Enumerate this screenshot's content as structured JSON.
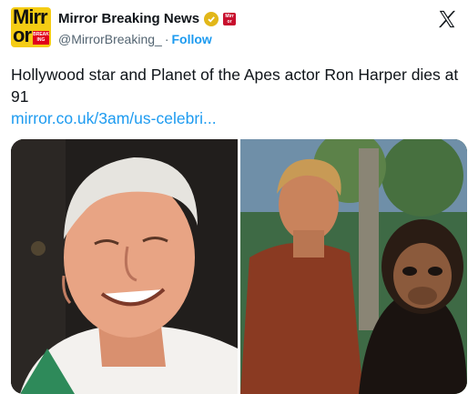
{
  "header": {
    "avatar_icon": "mirror-logo-icon",
    "avatar_text_top": "Mirr",
    "avatar_text_bottom": "or",
    "avatar_badge": "BREAK ING",
    "display_name": "Mirror Breaking News",
    "verified_icon": "gold-verified-badge-icon",
    "affiliate_icon": "mirror-affiliate-badge-icon",
    "affiliate_text": "Mirr or",
    "handle": "@MirrorBreaking_",
    "separator": "·",
    "follow_label": "Follow",
    "platform_icon": "x-logo-icon"
  },
  "tweet": {
    "text": "Hollywood star and Planet of the Apes actor Ron Harper dies at 91",
    "link": "mirror.co.uk/3am/us-celebri..."
  },
  "media": {
    "left_photo": "portrait-of-smiling-older-man",
    "right_photo": "planet-of-the-apes-still-actor-with-ape"
  },
  "colors": {
    "accent": "#1d9bf0",
    "text": "#0f1419",
    "secondary": "#536471",
    "brand_yellow": "#f5cc14",
    "brand_red": "#e1001a"
  }
}
